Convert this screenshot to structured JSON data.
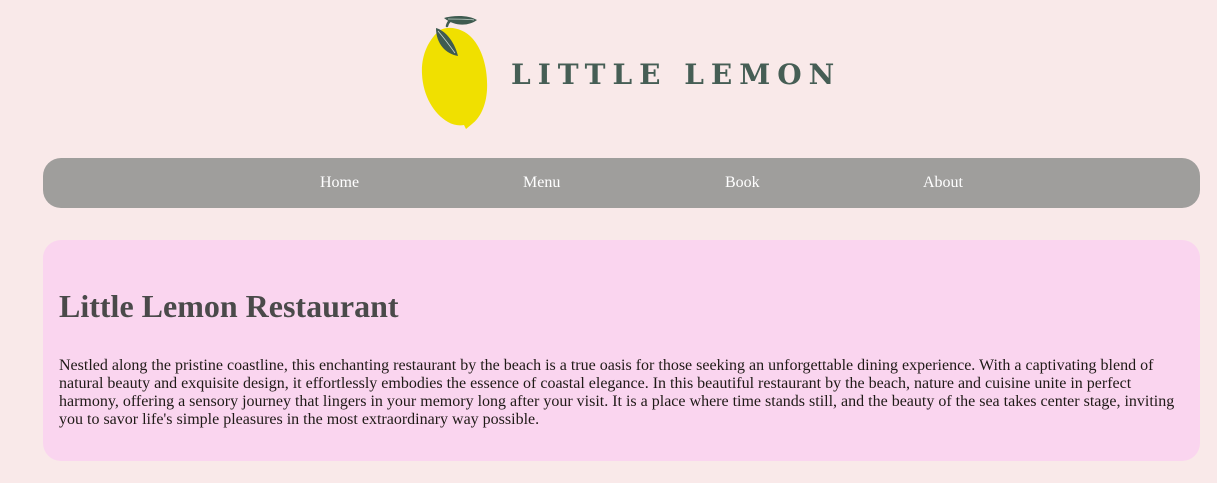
{
  "header": {
    "logo_text": "LITTLE LEMON"
  },
  "nav": {
    "items": [
      {
        "label": "Home"
      },
      {
        "label": "Menu"
      },
      {
        "label": "Book"
      },
      {
        "label": "About"
      }
    ]
  },
  "main": {
    "title": "Little Lemon Restaurant",
    "description": "Nestled along the pristine coastline, this enchanting restaurant by the beach is a true oasis for those seeking an unforgettable dining experience. With a captivating blend of natural beauty and exquisite design, it effortlessly embodies the essence of coastal elegance. In this beautiful restaurant by the beach, nature and cuisine unite in perfect harmony, offering a sensory journey that lingers in your memory long after your visit. It is a place where time stands still, and the beauty of the sea takes center stage, inviting you to savor life's simple pleasures in the most extraordinary way possible."
  },
  "colors": {
    "page_background": "#f9e9e9",
    "nav_background": "#9f9e9c",
    "card_background": "#fad5ef",
    "logo_text": "#465e55",
    "lemon": "#f0e000",
    "leaf": "#3f5b50"
  },
  "icons": {
    "logo": "lemon-logo-icon"
  }
}
